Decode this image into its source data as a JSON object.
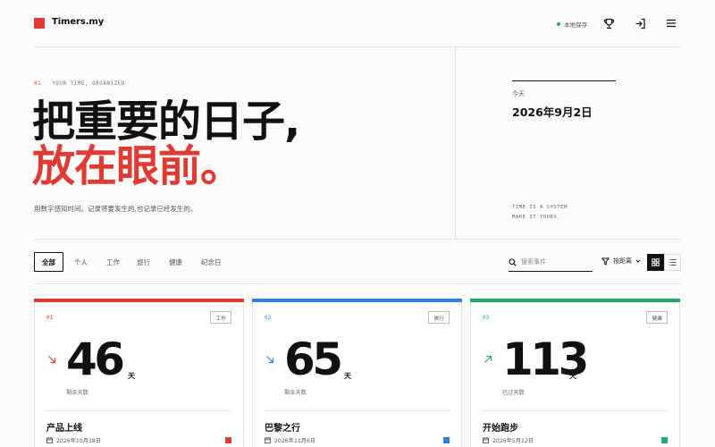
{
  "colors": {
    "accent_red": "#e03a35",
    "blue": "#2f7fe0",
    "green": "#1fa86a",
    "ink": "#111111"
  },
  "header": {
    "logo_icon": "red-square",
    "brand": "Timers.my",
    "saved_status": "本地保存",
    "icons": [
      "trophy-icon",
      "sign-in-icon",
      "menu-icon"
    ]
  },
  "hero": {
    "eyebrow_num": "01",
    "eyebrow_text": "YOUR TIME, ORGANIZED",
    "headline_line1": "把重要的日子,",
    "headline_line2": "放在眼前。",
    "subtext": "用数字感知时间。记录将要发生的,也记录已经发生的。",
    "today_label": "今天",
    "today_date": "2026年9月2日",
    "tagline_line1": "TIME IS A SYSTEM",
    "tagline_line2": "MAKE IT YOURS."
  },
  "filters": {
    "tabs": [
      {
        "label": "全部",
        "active": true
      },
      {
        "label": "个人",
        "active": false
      },
      {
        "label": "工作",
        "active": false
      },
      {
        "label": "旅行",
        "active": false
      },
      {
        "label": "健康",
        "active": false
      },
      {
        "label": "纪念日",
        "active": false
      }
    ],
    "search_placeholder": "搜索事件",
    "sort_label": "按距离",
    "view_modes": [
      "grid",
      "list"
    ],
    "active_view": "grid"
  },
  "cards": [
    {
      "num": "01",
      "tag": "工作",
      "days": "46",
      "unit": "天",
      "status": "剩余天数",
      "direction": "down",
      "title": "产品上线",
      "date": "2026年10月18日",
      "color": "#e03a35"
    },
    {
      "num": "02",
      "tag": "旅行",
      "days": "65",
      "unit": "天",
      "status": "剩余天数",
      "direction": "down",
      "title": "巴黎之行",
      "date": "2026年11月6日",
      "color": "#2f7fe0"
    },
    {
      "num": "03",
      "tag": "健康",
      "days": "113",
      "unit": "天",
      "status": "已过天数",
      "direction": "up",
      "title": "开始跑步",
      "date": "2026年5月12日",
      "color": "#1fa86a"
    }
  ]
}
